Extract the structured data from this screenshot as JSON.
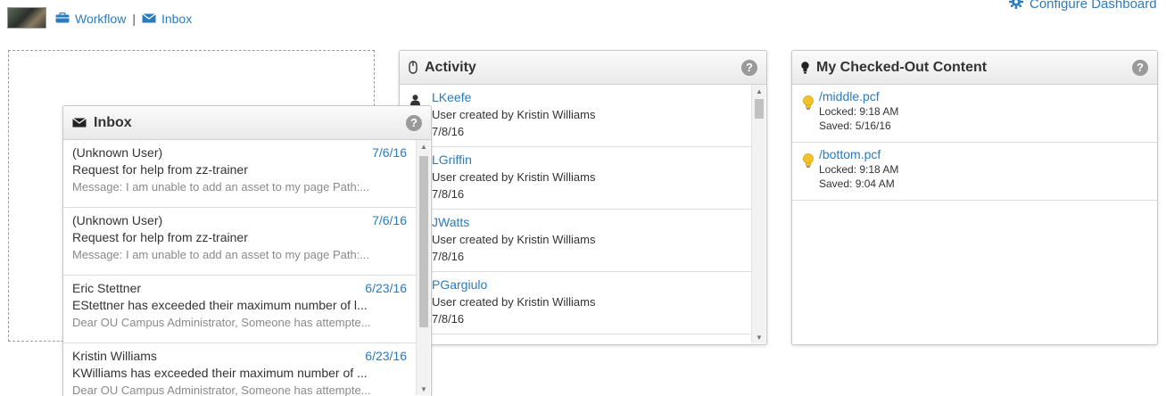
{
  "topbar": {
    "workflow_label": "Workflow",
    "separator": "|",
    "inbox_label": "Inbox",
    "configure_label": "Configure Dashboard"
  },
  "activity": {
    "title": "Activity",
    "help": "?",
    "items": [
      {
        "user": "LKeefe",
        "desc": "User created by Kristin Williams",
        "date": "7/8/16"
      },
      {
        "user": "LGriffin",
        "desc": "User created by Kristin Williams",
        "date": "7/8/16"
      },
      {
        "user": "JWatts",
        "desc": "User created by Kristin Williams",
        "date": "7/8/16"
      },
      {
        "user": "PGargiulo",
        "desc": "User created by Kristin Williams",
        "date": "7/8/16"
      }
    ]
  },
  "checked_out": {
    "title": "My Checked-Out Content",
    "help": "?",
    "items": [
      {
        "file": "/middle.pcf",
        "locked": "Locked: 9:18 AM",
        "saved": "Saved: 5/16/16"
      },
      {
        "file": "/bottom.pcf",
        "locked": "Locked: 9:18 AM",
        "saved": "Saved: 9:04 AM"
      }
    ]
  },
  "inbox": {
    "title": "Inbox",
    "help": "?",
    "items": [
      {
        "from": "(Unknown User)",
        "date": "7/6/16",
        "subject": "Request for help from zz-trainer",
        "message": "Message: I am unable to add an asset to my page Path:..."
      },
      {
        "from": "(Unknown User)",
        "date": "7/6/16",
        "subject": "Request for help from zz-trainer",
        "message": "Message: I am unable to add an asset to my page Path:..."
      },
      {
        "from": "Eric Stettner",
        "date": "6/23/16",
        "subject": "EStettner has exceeded their maximum number of l...",
        "message": "Dear OU Campus Administrator, Someone has attempte..."
      },
      {
        "from": "Kristin Williams",
        "date": "6/23/16",
        "subject": "KWilliams has exceeded their maximum number of ...",
        "message": "Dear OU Campus Administrator, Someone has attempte..."
      }
    ]
  },
  "icons": {
    "workflow": "briefcase-icon",
    "inbox": "envelope-icon",
    "configure": "gear-icon",
    "activity": "mouse-icon",
    "checked_out": "lightbulb-icon",
    "user": "user-icon",
    "file": "lightbulb-icon"
  },
  "colors": {
    "link": "#2a7bbf",
    "bulb": "#f2c22b",
    "help": "#9a9a9a"
  }
}
